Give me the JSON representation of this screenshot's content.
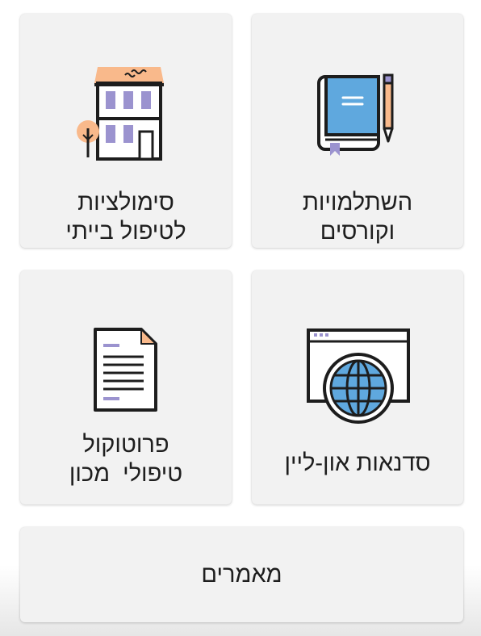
{
  "tiles": {
    "courses": {
      "line1": "השתלמויות",
      "line2": "וקורסים",
      "icon": "book-pencil-icon"
    },
    "simulations": {
      "line1": "סימולציות",
      "line2": "לטיפול בייתי",
      "icon": "building-icon"
    },
    "online": {
      "line1": "סדנאות און-ליין",
      "icon": "browser-globe-icon"
    },
    "protocol": {
      "line1": "פרוטוקול",
      "line2": "טיפולי  מכון",
      "icon": "document-icon"
    },
    "articles": {
      "line1": "מאמרים"
    }
  },
  "colors": {
    "card_background": "#f2f2f2",
    "icon_blue": "#5fa8de",
    "icon_lavender": "#9b93cf",
    "icon_peach": "#f9b98b",
    "icon_stroke": "#1d1d1d"
  }
}
